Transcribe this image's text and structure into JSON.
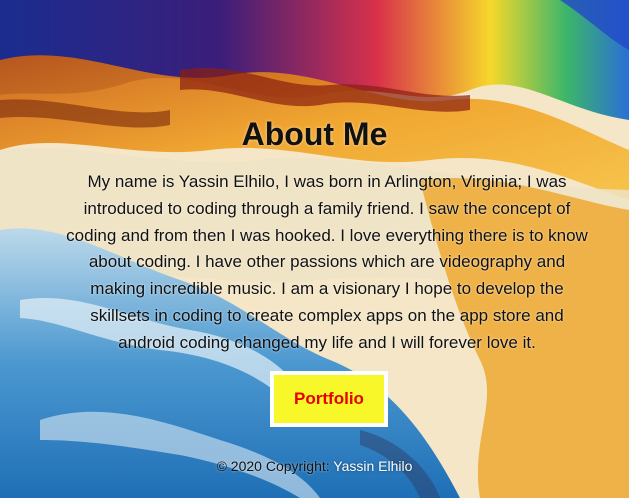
{
  "page": {
    "title": "About Me",
    "bio": "My name is Yassin Elhilo, I was born in Arlington, Virginia; I was introduced to coding through a family friend. I saw the concept of coding and from then I was hooked. I love everything there is to know about coding. I have other passions which are videography and making incredible music. I am a visionary I hope to develop the skillsets in coding to create complex apps on the app store and android coding changed my life and I will forever love it.",
    "button_label": "Portfolio"
  },
  "footer": {
    "copyright": "© 2020 Copyright:",
    "author": "Yassin Elhilo"
  },
  "colors": {
    "button_bg": "#f7f72a",
    "button_text": "#e60000",
    "button_border": "#ffffff",
    "text": "#111111"
  }
}
